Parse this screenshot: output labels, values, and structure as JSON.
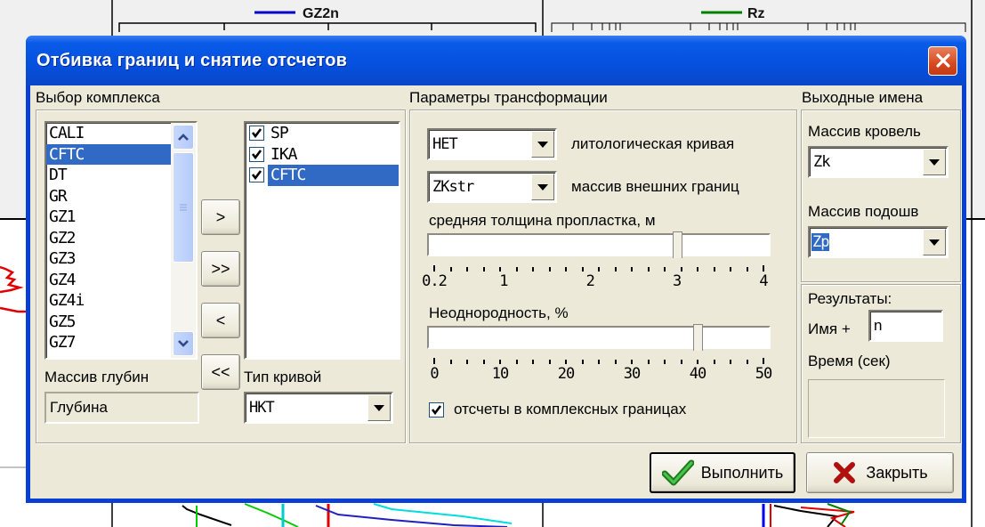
{
  "background": {
    "legend_left": "GZ2n",
    "legend_right": "Rz",
    "legend_left_color": "#0000cc",
    "legend_right_color": "#008000"
  },
  "dialog": {
    "title": "Отбивка границ и снятие отсчетов",
    "close_icon": "close-icon"
  },
  "complex": {
    "section_title": "Выбор комплекса",
    "available": [
      "CALI",
      "CFTC",
      "DT",
      "GR",
      "GZ1",
      "GZ2",
      "GZ3",
      "GZ4",
      "GZ4i",
      "GZ5",
      "GZ7"
    ],
    "available_selected": "CFTC",
    "selected": [
      {
        "label": "SP",
        "checked": true
      },
      {
        "label": "IKA",
        "checked": true
      },
      {
        "label": "CFTC",
        "checked": true
      }
    ],
    "selected_highlight": "CFTC",
    "buttons": {
      "add": ">",
      "add_all": ">>",
      "remove": "<",
      "remove_all": "<<"
    },
    "depth_array_label": "Массив глубин",
    "depth_array_value": "Глубина",
    "curve_type_label": "Тип кривой",
    "curve_type_value": "НКТ"
  },
  "transform": {
    "section_title": "Параметры трансформации",
    "lithology_value": "НЕТ",
    "lithology_label": "литологическая кривая",
    "external_bounds_value": "ZKstr",
    "external_bounds_label": "массив внешних границ",
    "thickness_label": "средняя толщина пропластка, м",
    "thickness_value": 3,
    "thickness_range": [
      0.2,
      4
    ],
    "thickness_ticks": [
      "0.2",
      "1",
      "2",
      "3",
      "4"
    ],
    "heterogeneity_label": "Неоднородность, %",
    "heterogeneity_value": 40,
    "heterogeneity_range": [
      0,
      50
    ],
    "heterogeneity_ticks": [
      "0",
      "10",
      "20",
      "30",
      "40",
      "50"
    ],
    "complex_bounds_checkbox_label": "отсчеты в комплексных границах",
    "complex_bounds_checked": true
  },
  "output": {
    "section_title": "Выходные имена",
    "roof_label": "Массив кровель",
    "roof_value": "Zk",
    "sole_label": "Массив подошв",
    "sole_value": "Zp",
    "results_label": "Результаты:",
    "name_plus_label": "Имя +",
    "name_plus_value": "n",
    "time_label": "Время (сек)",
    "time_value": ""
  },
  "footer": {
    "run_label": "Выполнить",
    "close_label": "Закрыть"
  }
}
